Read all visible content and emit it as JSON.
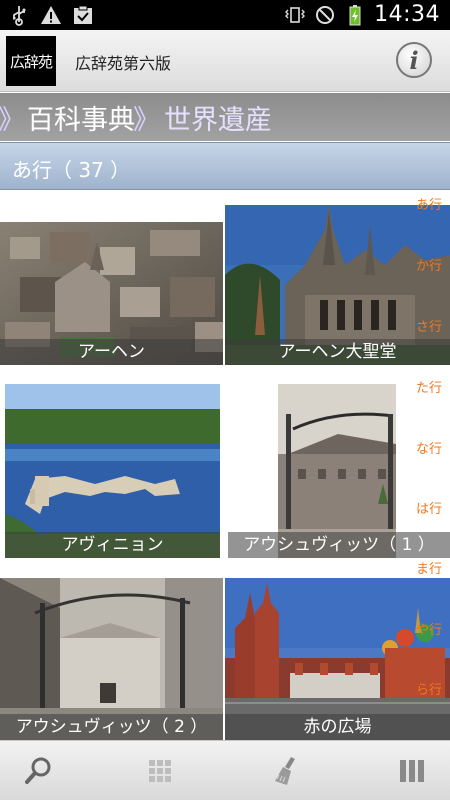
{
  "status_bar": {
    "time": "14:34",
    "icons": [
      "usb-icon",
      "warning-icon",
      "clipboard-check-icon",
      "vibrate-icon",
      "no-signal-icon",
      "battery-charging-icon"
    ]
  },
  "app": {
    "logo_text": "広辞苑",
    "title": "広辞苑第六版",
    "info_label": "i"
  },
  "breadcrumb": {
    "separator": "》",
    "items": [
      "百科事典",
      "世界遺産"
    ]
  },
  "section": {
    "label": "あ行（ 37 ）"
  },
  "tiles": [
    {
      "caption": "アーヘン"
    },
    {
      "caption": "アーヘン大聖堂"
    },
    {
      "caption": "アヴィニョン"
    },
    {
      "caption": "アウシュヴィッツ（ 1 ）"
    },
    {
      "caption": "アウシュヴィッツ（ 2 ）"
    },
    {
      "caption": "赤の広場"
    }
  ],
  "index": [
    "あ行",
    "か行",
    "さ行",
    "た行",
    "な行",
    "は行",
    "ま行",
    "や行",
    "ら行"
  ],
  "toolbar": {
    "buttons": [
      "search-icon",
      "grid-icon",
      "brush-icon",
      "columns-icon"
    ]
  },
  "colors": {
    "index_text": "#f07820",
    "section_bg": "#b1c3da",
    "breadcrumb_bg": "#979797"
  }
}
